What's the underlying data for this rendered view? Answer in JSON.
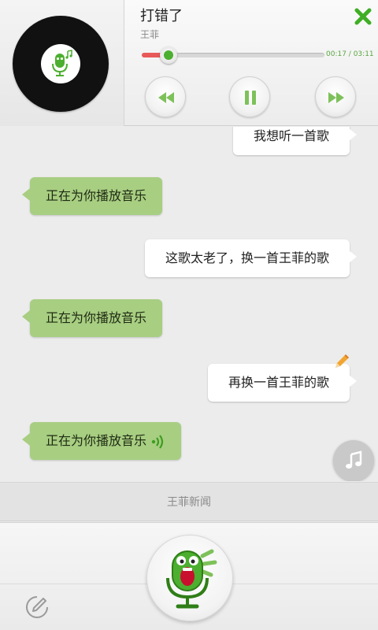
{
  "player": {
    "title": "打错了",
    "artist": "王菲",
    "elapsed": "00:17",
    "duration": "03:11",
    "time_separator": " / ",
    "progress_fraction": 0.146,
    "icons": {
      "cover": "vinyl-record-icon",
      "close": "close-x-icon",
      "prev": "rewind-icon",
      "pause": "pause-icon",
      "next": "fast-forward-icon"
    },
    "colors": {
      "accent": "#4caf2f",
      "progress": "#e85a5a",
      "close": "#3fae24"
    }
  },
  "chat": {
    "messages": [
      {
        "sender": "user",
        "text": "我想听一首歌"
      },
      {
        "sender": "bot",
        "text": "正在为你播放音乐"
      },
      {
        "sender": "user",
        "text": "这歌太老了，换一首王菲的歌"
      },
      {
        "sender": "bot",
        "text": "正在为你播放音乐"
      },
      {
        "sender": "user",
        "text": "再换一首王菲的歌"
      },
      {
        "sender": "bot",
        "text": "正在为你播放音乐"
      }
    ],
    "colors": {
      "bot_bubble": "#a8ce82",
      "user_bubble": "#ffffff"
    }
  },
  "suggestion": {
    "text": "王菲新闻"
  },
  "bottom_bar": {
    "mic_icon": "microphone-mascot-icon",
    "keyboard_icon": "pencil-circle-icon"
  }
}
